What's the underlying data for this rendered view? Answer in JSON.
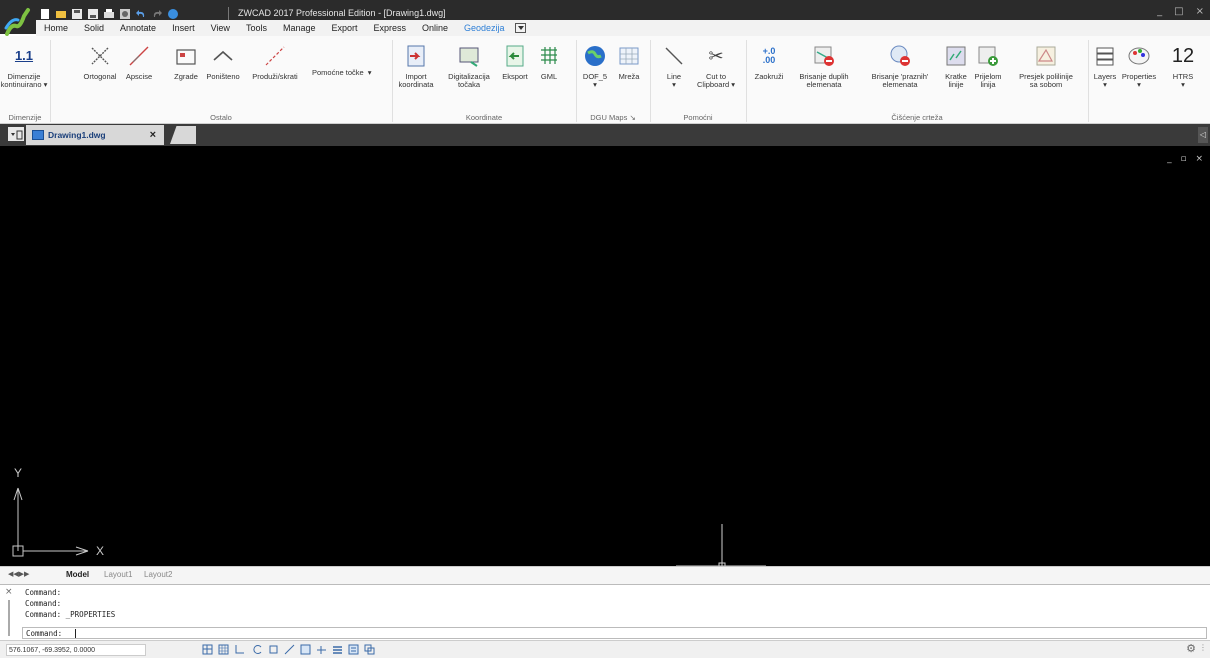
{
  "app": {
    "title": "ZWCAD 2017 Professional Edition - [Drawing1.dwg]"
  },
  "quick_access": {
    "icons": [
      "new-icon",
      "open-icon",
      "save-icon",
      "save-as-icon",
      "print-icon",
      "plot-preview-icon",
      "undo-icon",
      "redo-icon",
      "help-icon"
    ]
  },
  "window_controls": [
    "_",
    "□",
    "×"
  ],
  "menu": {
    "tabs": [
      {
        "label": "Home",
        "active": false
      },
      {
        "label": "Solid",
        "active": false
      },
      {
        "label": "Annotate",
        "active": false
      },
      {
        "label": "Insert",
        "active": false
      },
      {
        "label": "View",
        "active": false
      },
      {
        "label": "Tools",
        "active": false
      },
      {
        "label": "Manage",
        "active": false
      },
      {
        "label": "Export",
        "active": false
      },
      {
        "label": "Express",
        "active": false
      },
      {
        "label": "Online",
        "active": false
      },
      {
        "label": "Geodezija",
        "active": true
      }
    ]
  },
  "ribbon": {
    "buttons": {
      "dimenzije": "Dimenzije\nkontinuirano ▾",
      "ortogonal": "Ortogonal",
      "apscise": "Apscise",
      "zgrade": "Zgrade",
      "ponisteno": "Poništeno",
      "produzi": "Produži/skrati",
      "pomocne": "Pomoćne točke",
      "import": "Import\nkoordinata",
      "digitalizacija": "Digitalizacija\ntočaka",
      "eksport": "Eksport",
      "gml": "GML",
      "dof5": "DOF_5\n▾",
      "mreza": "Mreža",
      "line": "Line\n▾",
      "cutto": "Cut to\nClipboard ▾",
      "zaokruzi": "Zaokruži",
      "brisanje_duplih": "Brisanje duplih\nelemenata",
      "brisanje_praznih": "Brisanje 'praznih'\nelemenata",
      "kratke": "Kratke\nlinije",
      "prijelom": "Prijelom\nlinija",
      "presjek": "Presjek polilinije\nsa sobom",
      "layers": "Layers\n▾",
      "properties": "Properties\n▾",
      "htrs": "HTRS\n▾"
    },
    "dimenzije_icon_text": "1.1",
    "zaokruzi_icon_text": "+.0\n.00",
    "htrs_icon_text": "12",
    "groups": {
      "dimenzije": "Dimenzije",
      "ostalo": "Ostalo",
      "koordinate": "Koordinate",
      "dgu_maps": "DGU Maps",
      "pomocni": "Pomoćni",
      "ciscenje": "Čišćenje crteža"
    }
  },
  "document": {
    "tab_label": "Drawing1.dwg"
  },
  "viewport": {
    "axis_x": "X",
    "axis_y": "Y",
    "controls": "_ ▫ ×"
  },
  "layouts": {
    "nav": "◀ ◀ ▶ ▶",
    "tabs": [
      {
        "label": "Model",
        "active": true
      },
      {
        "label": "Layout1",
        "active": false
      },
      {
        "label": "Layout2",
        "active": false
      }
    ]
  },
  "command": {
    "history": [
      "Command:",
      "Command:",
      "Command: _PROPERTIES"
    ],
    "prompt": "Command:"
  },
  "status": {
    "coordinates": "576.1067, -69.3952, 0.0000"
  },
  "colors": {
    "title_bg": "#2b2b2b",
    "accent_blue": "#2e7fd6",
    "viewport_bg": "#000000"
  }
}
